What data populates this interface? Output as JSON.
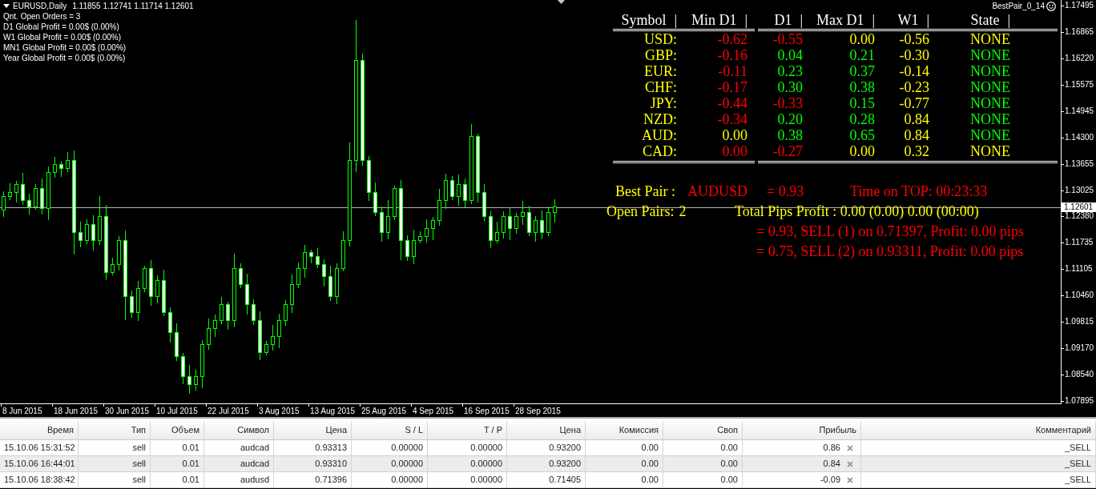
{
  "chart": {
    "symbol": "EURUSD,Daily",
    "quotes": "1.11855 1.12741 1.11714 1.12601",
    "info_lines": [
      "Qnt. Open Orders = 3",
      "D1 Global Profit = 0.00$ (0.00%)",
      "W1 Global Profit = 0.00$ (0.00%)",
      "MN1 Global Profit = 0.00$ (0.00%)",
      "Year Global Profit = 0.00$ (0.00%)"
    ],
    "indicator_name": "BestPair_0_14",
    "price_axis": [
      "1.17495",
      "1.16865",
      "1.16220",
      "1.15575",
      "1.14945",
      "1.14300",
      "1.13655",
      "1.13025",
      "1.12380",
      "1.11735",
      "1.11105",
      "1.10460",
      "1.09815",
      "1.09170",
      "1.08540",
      "1.07895"
    ],
    "current_price": "1.12601",
    "date_axis": [
      "8 Jun 2015",
      "18 Jun 2015",
      "30 Jun 2015",
      "10 Jul 2015",
      "22 Jul 2015",
      "3 Aug 2015",
      "13 Aug 2015",
      "25 Aug 2015",
      "4 Sep 2015",
      "16 Sep 2015",
      "28 Sep 2015"
    ]
  },
  "strength_table": {
    "columns": [
      {
        "label": "Symbol",
        "separator": "|"
      },
      {
        "label": "Min D1",
        "separator": "|"
      },
      {
        "label": "D1",
        "separator": "|"
      },
      {
        "label": "Max D1",
        "separator": "|"
      },
      {
        "label": "W1",
        "separator": "|"
      },
      {
        "label": "State",
        "separator": "|"
      }
    ],
    "rows": [
      {
        "symbol": "USD:",
        "values": [
          {
            "text": "-0.62",
            "color": "#ff0000"
          },
          {
            "text": "-0.55",
            "color": "#ff0000"
          },
          {
            "text": "0.00",
            "color": "#ffff00"
          },
          {
            "text": "-0.56",
            "color": "#ffff00"
          },
          {
            "text": "NONE",
            "color": "#ffff00"
          }
        ]
      },
      {
        "symbol": "GBP:",
        "values": [
          {
            "text": "-0.16",
            "color": "#ff0000"
          },
          {
            "text": "0.04",
            "color": "#00ff00"
          },
          {
            "text": "0.21",
            "color": "#00ff00"
          },
          {
            "text": "-0.30",
            "color": "#ffff00"
          },
          {
            "text": "NONE",
            "color": "#00ff00"
          }
        ]
      },
      {
        "symbol": "EUR:",
        "values": [
          {
            "text": "-0.11",
            "color": "#ff0000"
          },
          {
            "text": "0.23",
            "color": "#00ff00"
          },
          {
            "text": "0.37",
            "color": "#00ff00"
          },
          {
            "text": "-0.14",
            "color": "#ffff00"
          },
          {
            "text": "NONE",
            "color": "#00ff00"
          }
        ]
      },
      {
        "symbol": "CHF:",
        "values": [
          {
            "text": "-0.17",
            "color": "#ff0000"
          },
          {
            "text": "0.30",
            "color": "#00ff00"
          },
          {
            "text": "0.38",
            "color": "#00ff00"
          },
          {
            "text": "-0.23",
            "color": "#ffff00"
          },
          {
            "text": "NONE",
            "color": "#00ff00"
          }
        ]
      },
      {
        "symbol": "JPY:",
        "values": [
          {
            "text": "-0.44",
            "color": "#ff0000"
          },
          {
            "text": "-0.33",
            "color": "#ff0000"
          },
          {
            "text": "0.15",
            "color": "#00ff00"
          },
          {
            "text": "-0.77",
            "color": "#ffff00"
          },
          {
            "text": "NONE",
            "color": "#00ff00"
          }
        ]
      },
      {
        "symbol": "NZD:",
        "values": [
          {
            "text": "-0.34",
            "color": "#ff0000"
          },
          {
            "text": "0.20",
            "color": "#00ff00"
          },
          {
            "text": "0.28",
            "color": "#00ff00"
          },
          {
            "text": "0.84",
            "color": "#ffff00"
          },
          {
            "text": "NONE",
            "color": "#00ff00"
          }
        ]
      },
      {
        "symbol": "AUD:",
        "values": [
          {
            "text": "0.00",
            "color": "#ffff00"
          },
          {
            "text": "0.38",
            "color": "#00ff00"
          },
          {
            "text": "0.65",
            "color": "#00ff00"
          },
          {
            "text": "0.84",
            "color": "#ffff00"
          },
          {
            "text": "NONE",
            "color": "#00ff00"
          }
        ]
      },
      {
        "symbol": "CAD:",
        "values": [
          {
            "text": "0.00",
            "color": "#ff0000"
          },
          {
            "text": "-0.27",
            "color": "#ff0000"
          },
          {
            "text": "0.00",
            "color": "#ffff00"
          },
          {
            "text": "0.32",
            "color": "#ffff00"
          },
          {
            "text": "NONE",
            "color": "#ffff00"
          }
        ]
      }
    ]
  },
  "best_pair": {
    "label": "Best Pair :",
    "pair": "AUDUSD",
    "value": "= 0.93",
    "time_on_top": "Time on TOP: 00:23:33"
  },
  "open_pairs": {
    "label": "Open Pairs:",
    "count": "2",
    "total_pips": "Total Pips Profit : 0.00 (0.00) 0.00 (00:00)"
  },
  "open_pair_lines": [
    "= 0.93, SELL (1) on 0.71397, Profit: 0.00 pips",
    "= 0.75, SELL (2) on 0.93311, Profit: 0.00 pips"
  ],
  "trades_table": {
    "columns": [
      "Время",
      "Тип",
      "Объем",
      "Символ",
      "Цена",
      "S / L",
      "T / P",
      "Цена",
      "Комиссия",
      "Своп",
      "Прибыль",
      "Комментарий"
    ],
    "rows": [
      {
        "time": "15.10.06 15:31:52",
        "type": "sell",
        "volume": "0.01",
        "symbol": "audcad",
        "open_price": "0.93313",
        "sl": "0.00000",
        "tp": "0.00000",
        "price": "0.93200",
        "commission": "0.00",
        "swap": "0.00",
        "profit": "0.86",
        "comment": "_SELL"
      },
      {
        "time": "15.10.06 16:44:01",
        "type": "sell",
        "volume": "0.01",
        "symbol": "audcad",
        "open_price": "0.93310",
        "sl": "0.00000",
        "tp": "0.00000",
        "price": "0.93200",
        "commission": "0.00",
        "swap": "0.00",
        "profit": "0.84",
        "comment": "_SELL"
      },
      {
        "time": "15.10.06 18:38:42",
        "type": "sell",
        "volume": "0.01",
        "symbol": "audusd",
        "open_price": "0.71396",
        "sl": "0.00000",
        "tp": "0.00000",
        "price": "0.71405",
        "commission": "0.00",
        "swap": "0.00",
        "profit": "-0.09",
        "comment": "_SELL"
      }
    ]
  }
}
